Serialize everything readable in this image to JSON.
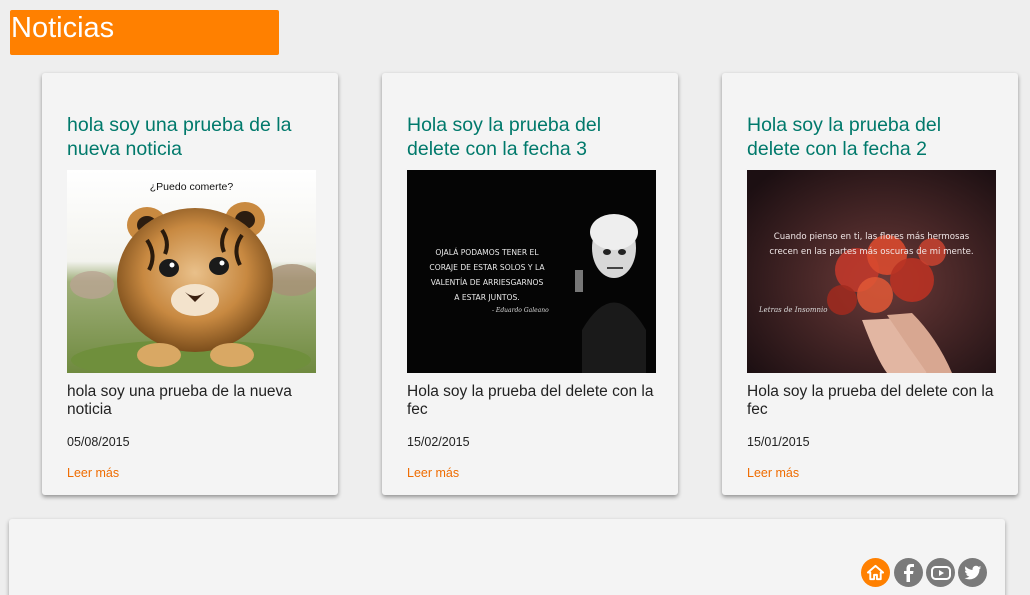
{
  "header": {
    "title": "Noticias"
  },
  "news": [
    {
      "title": "hola soy una prueba de la nueva noticia",
      "image_caption": "¿Puedo comerte?",
      "summary": "hola soy una prueba de la nueva noticia",
      "date": "05/08/2015",
      "link": "Leer más"
    },
    {
      "title": "Hola soy la prueba del delete con la fecha 3",
      "image_quote": [
        "OJALÁ PODAMOS TENER EL",
        "CORAJE DE ESTAR SOLOS Y LA",
        "VALENTÍA DE ARRIESGARNOS",
        "A ESTAR JUNTOS."
      ],
      "image_signature": "- Eduardo Galeano",
      "summary": "Hola soy la prueba del delete con la fec",
      "date": "15/02/2015",
      "link": "Leer más"
    },
    {
      "title": "Hola soy la prueba del delete con la fecha 2",
      "image_quote": [
        "Cuando pienso en ti, las flores más hermosas",
        "crecen en las partes más oscuras de mi mente."
      ],
      "image_signature": "Letras de Insomnio",
      "summary": "Hola soy la prueba del delete con la fec",
      "date": "15/01/2015",
      "link": "Leer más"
    }
  ],
  "footer": {
    "social": [
      "home-icon",
      "facebook-icon",
      "youtube-icon",
      "twitter-icon"
    ]
  },
  "colors": {
    "accent": "#ff8000",
    "title": "#00796b",
    "link": "#ef6c00",
    "icon_gray": "#7a7a7a"
  }
}
